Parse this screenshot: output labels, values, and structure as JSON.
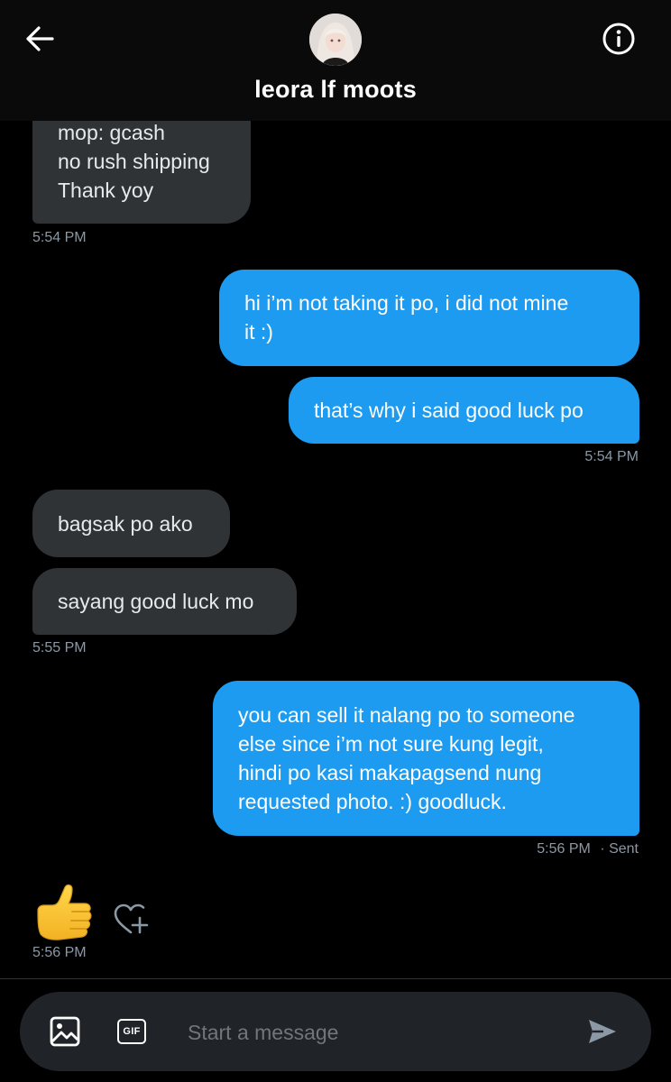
{
  "header": {
    "title": "leora lf moots",
    "back_icon": "arrow-left-icon",
    "info_icon": "info-circle-icon"
  },
  "messages": [
    {
      "direction": "in",
      "lines": [
        "mop: gcash",
        "no rush shipping",
        "Thank yoy"
      ]
    },
    {
      "direction": "in",
      "timestamp": "5:54 PM"
    },
    {
      "direction": "out",
      "lines": [
        "hi i’m not taking it po, i did not mine",
        "it :)"
      ]
    },
    {
      "direction": "out",
      "lines": [
        "that’s why i said good luck po"
      ],
      "timestamp": "5:54 PM"
    },
    {
      "direction": "in",
      "lines": [
        "bagsak po ako"
      ]
    },
    {
      "direction": "in",
      "lines": [
        "sayang good luck mo"
      ],
      "timestamp": "5:55 PM"
    },
    {
      "direction": "out",
      "lines": [
        "you can sell it nalang po to someone",
        "else since i’m not sure kung legit,",
        "hindi po kasi makapagsend nung",
        "requested photo. :) goodluck."
      ],
      "timestamp": "5:56 PM",
      "status": "· Sent"
    },
    {
      "direction": "in",
      "emoji": "thumbs-up-emoji",
      "timestamp": "5:56 PM"
    }
  ],
  "composer": {
    "placeholder": "Start a message",
    "gif_label": "GIF",
    "media_icon": "image-icon",
    "send_icon": "send-icon",
    "react_icon": "heart-plus-icon"
  },
  "colors": {
    "background": "#000000",
    "incoming_bubble": "#2f3336",
    "outgoing_bubble": "#1d9bf0",
    "timestamp": "#8b98a5"
  }
}
